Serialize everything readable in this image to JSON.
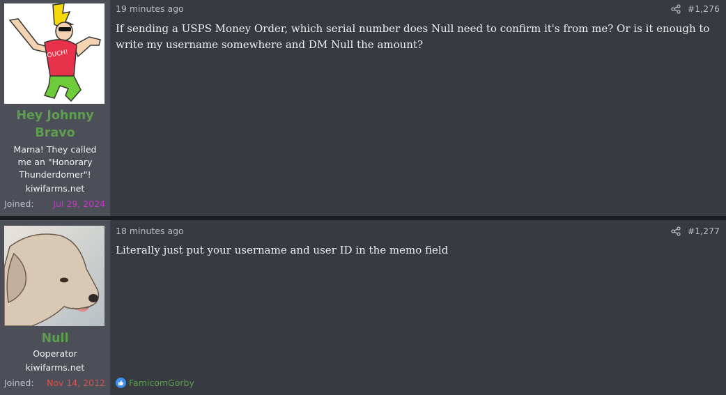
{
  "posts": [
    {
      "username": "Hey Johnny Bravo",
      "user_title": "Mama! They called me an \"Honorary Thunderdomer\"!",
      "user_domain": "kiwifarms.net",
      "joined_label": "Joined:",
      "joined_date": "Jul 29, 2024",
      "joined_color": "#cc33cc",
      "timestamp": "19 minutes ago",
      "post_number": "#1,276",
      "body": "If sending a USPS Money Order, which serial number does Null need to confirm it's from me? Or is it enough to write my username somewhere and DM Null the amount?",
      "avatar_icon": "johnny-bravo-avatar"
    },
    {
      "username": "Null",
      "user_title": "Ooperator",
      "user_domain": "kiwifarms.net",
      "joined_label": "Joined:",
      "joined_date": "Nov 14, 2012",
      "joined_color": "#d9534f",
      "timestamp": "18 minutes ago",
      "post_number": "#1,277",
      "body": "Literally just put your username and user ID in the memo field",
      "avatar_icon": "dog-avatar",
      "reaction_user": "FamicomGorby",
      "reaction_icon": "like-icon"
    }
  ],
  "colors": {
    "username": "#5d9e4f",
    "post_bg": "#383a41",
    "user_bg": "#4c4f57",
    "like": "#3b8ff0"
  }
}
